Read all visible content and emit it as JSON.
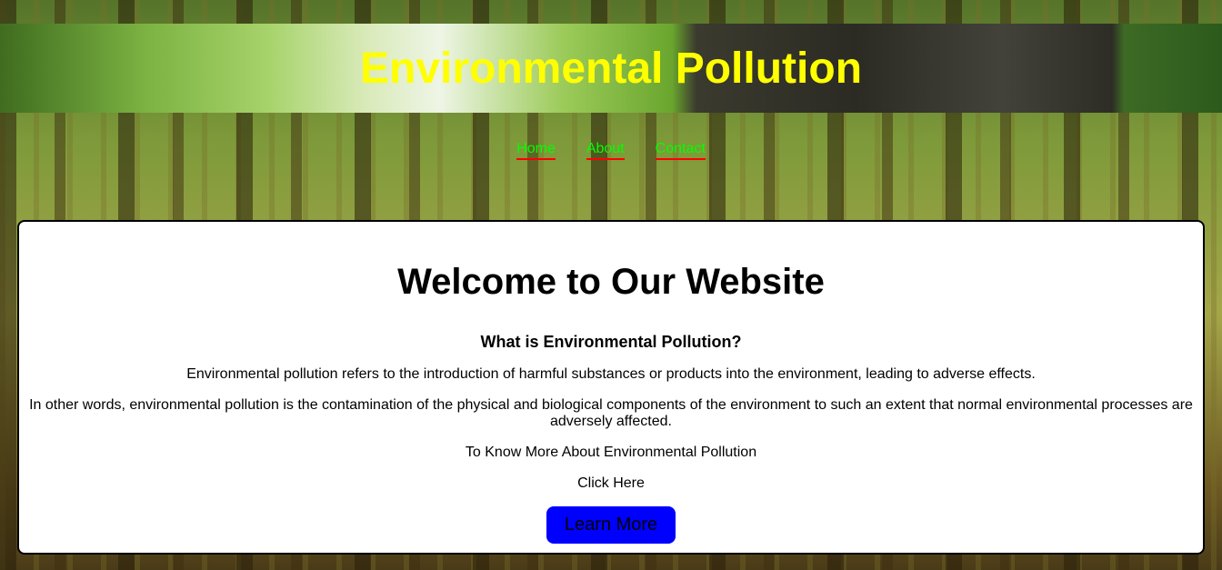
{
  "header": {
    "title": "Environmental Pollution"
  },
  "nav": {
    "items": [
      {
        "label": "Home"
      },
      {
        "label": "About"
      },
      {
        "label": "Contact"
      }
    ]
  },
  "main": {
    "heading": "Welcome to Our Website",
    "subheading": "What is Environmental Pollution?",
    "paragraph1": "Environmental pollution refers to the introduction of harmful substances or products into the environment, leading to adverse effects.",
    "paragraph2": "In other words, environmental pollution is the contamination of the physical and biological components of the environment to such an extent that normal environmental processes are adversely affected.",
    "paragraph3": "To Know More About Environmental Pollution",
    "paragraph4": "Click Here",
    "button_label": "Learn More"
  },
  "colors": {
    "title": "#ffff00",
    "nav_link": "#00ff00",
    "nav_underline": "#ff0000",
    "button_bg": "#0000ff",
    "card_bg": "#ffffff"
  },
  "background": {
    "description_icon": "forest-background"
  }
}
